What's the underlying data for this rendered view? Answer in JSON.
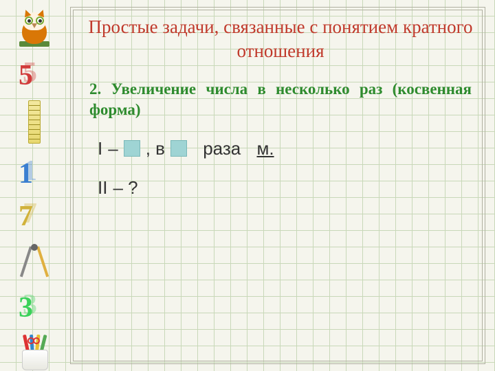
{
  "title": "Простые задачи, связанные с понятием кратного отношения",
  "subtitle": "2. Увеличение числа в несколько раз (косвенная форма)",
  "line1": {
    "roman": "I",
    "dash": "–",
    "comma_v": ", в",
    "raza": "раза",
    "m": "м."
  },
  "line2": {
    "roman": "II",
    "dash_q": "– ?"
  },
  "sidebar_numbers": [
    "5",
    "1",
    "7",
    "3"
  ]
}
